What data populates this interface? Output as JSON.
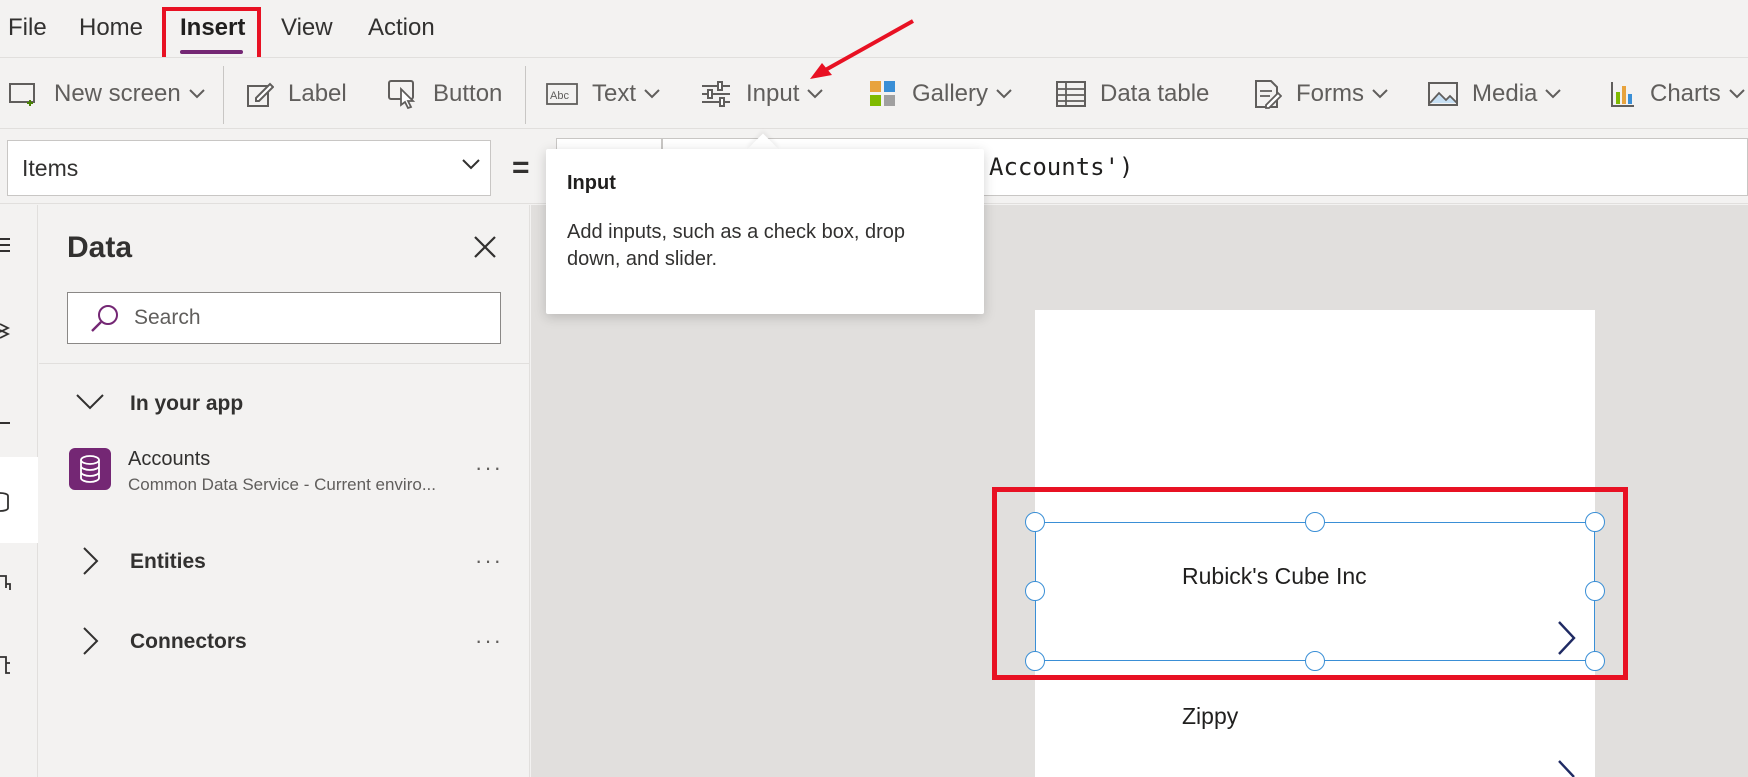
{
  "menu": {
    "items": [
      "File",
      "Home",
      "Insert",
      "View",
      "Action"
    ],
    "active": "Insert"
  },
  "ribbon": {
    "new_screen": "New screen",
    "label": "Label",
    "button": "Button",
    "text": "Text",
    "input": "Input",
    "gallery": "Gallery",
    "data_table": "Data table",
    "forms": "Forms",
    "media": "Media",
    "charts": "Charts"
  },
  "formula_bar": {
    "property": "Items",
    "equals": "=",
    "formula_visible": "Accounts')"
  },
  "tooltip": {
    "title": "Input",
    "description": "Add inputs, such as a check box, drop down, and slider."
  },
  "data_panel": {
    "title": "Data",
    "search_placeholder": "Search",
    "sections": {
      "in_your_app": "In your app",
      "entities": "Entities",
      "connectors": "Connectors"
    },
    "data_source": {
      "name": "Accounts",
      "subtitle": "Common Data Service - Current enviro..."
    },
    "ellipsis": "···"
  },
  "gallery": {
    "items": [
      "Rubick's Cube Inc",
      "Zippy"
    ]
  },
  "colors": {
    "accent": "#742774",
    "highlight": "#e81123",
    "selection": "#3a8fd6"
  }
}
